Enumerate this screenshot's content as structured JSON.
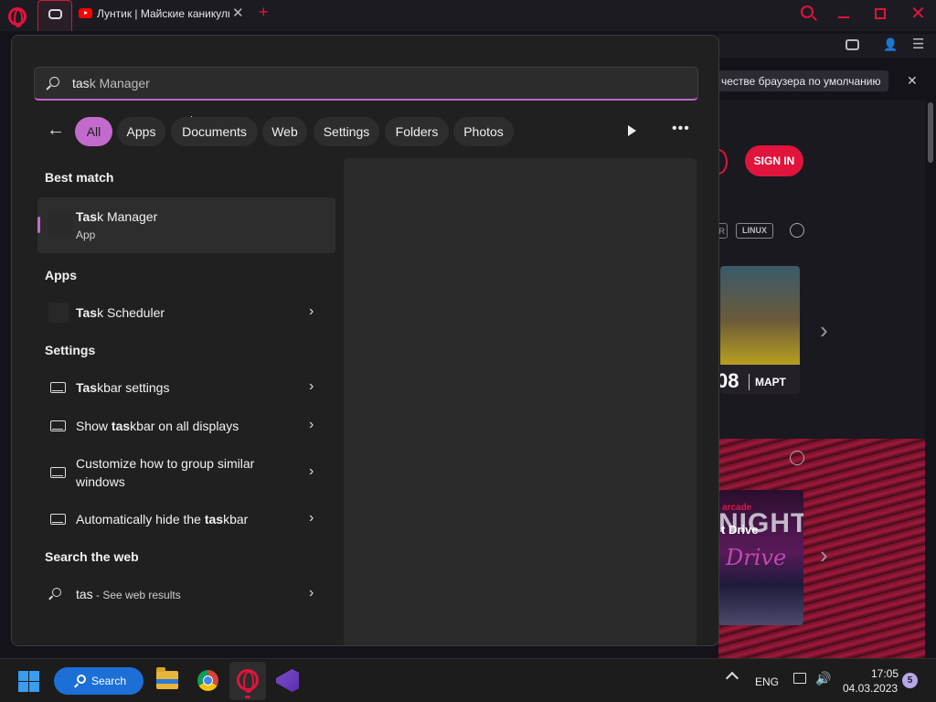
{
  "browser": {
    "tabs": [
      {
        "label": "",
        "icon": "gamepad-icon",
        "active": true
      },
      {
        "label": "Лунтик | Майские каникулы",
        "icon": "youtube-icon",
        "active": false
      }
    ],
    "new_tab_label": "+",
    "default_browser_bar": "честве браузера по умолчанию",
    "page": {
      "sign_in_label": "SIGN IN",
      "platform_tag_partial": "R",
      "platform_tag_linux": "LINUX",
      "game_card_1": {
        "day": "08",
        "month": "МАРТ"
      },
      "game_card_2": {
        "tag": "arcade",
        "title": "t Drive",
        "logo_text": "NIGHT",
        "logo_sub": "Drive"
      }
    },
    "accent_color": "#e0143c"
  },
  "search": {
    "query_typed": "tas",
    "query_suggestion": "k Manager",
    "filters": [
      {
        "label": "All",
        "active": true
      },
      {
        "label": "Apps",
        "active": false
      },
      {
        "label": "Documents",
        "active": false
      },
      {
        "label": "Web",
        "active": false
      },
      {
        "label": "Settings",
        "active": false
      },
      {
        "label": "Folders",
        "active": false
      },
      {
        "label": "Photos",
        "active": false
      }
    ],
    "sections": {
      "best_match": "Best match",
      "apps": "Apps",
      "settings": "Settings",
      "web": "Search the web"
    },
    "best_match": {
      "match": "Tas",
      "rest": "k Manager",
      "type": "App"
    },
    "apps": [
      {
        "match": "Tas",
        "rest": "k Scheduler"
      }
    ],
    "settings": [
      {
        "pre": "",
        "match": "Tas",
        "rest": "kbar settings"
      },
      {
        "pre": "Show ",
        "match": "tas",
        "rest": "kbar on all displays"
      },
      {
        "pre": "Customize how to group similar windows",
        "match": "",
        "rest": ""
      },
      {
        "pre": "Automatically hide the ",
        "match": "tas",
        "rest": "kbar"
      }
    ],
    "web": {
      "query": "tas",
      "suffix": " - See web results"
    },
    "accent_color": "#c26bcc"
  },
  "taskbar": {
    "search_label": "Search",
    "language": "ENG",
    "time": "17:05",
    "date": "04.03.2023",
    "notification_count": "5",
    "search_color": "#1c6fd6"
  }
}
